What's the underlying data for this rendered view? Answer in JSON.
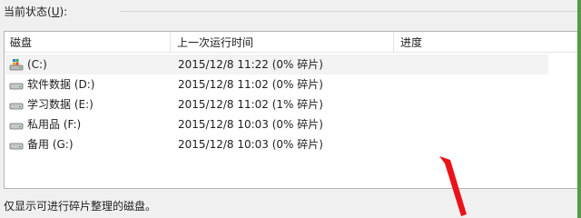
{
  "status_label": "当前状态(",
  "status_hotkey": "U",
  "status_suffix": "):",
  "columns": [
    "磁盘",
    "上一次运行时间",
    "进度"
  ],
  "rows": [
    {
      "disk": "(C:)",
      "time": "2015/12/8 11:22 (0% 碎片)",
      "icon": "system-drive-icon"
    },
    {
      "disk": "软件数据 (D:)",
      "time": "2015/12/8 11:02 (0% 碎片)",
      "icon": "drive-icon"
    },
    {
      "disk": "学习数据 (E:)",
      "time": "2015/12/8 11:02 (1% 碎片)",
      "icon": "drive-icon"
    },
    {
      "disk": "私用品 (F:)",
      "time": "2015/12/8 10:03 (0% 碎片)",
      "icon": "drive-icon"
    },
    {
      "disk": "备用 (G:)",
      "time": "2015/12/8 10:03 (0% 碎片)",
      "icon": "drive-icon"
    }
  ],
  "footer": "仅显示可进行碎片整理的磁盘。",
  "colors": {
    "arrow": "#e8141a",
    "accent_edge": "#4f9d3d"
  }
}
